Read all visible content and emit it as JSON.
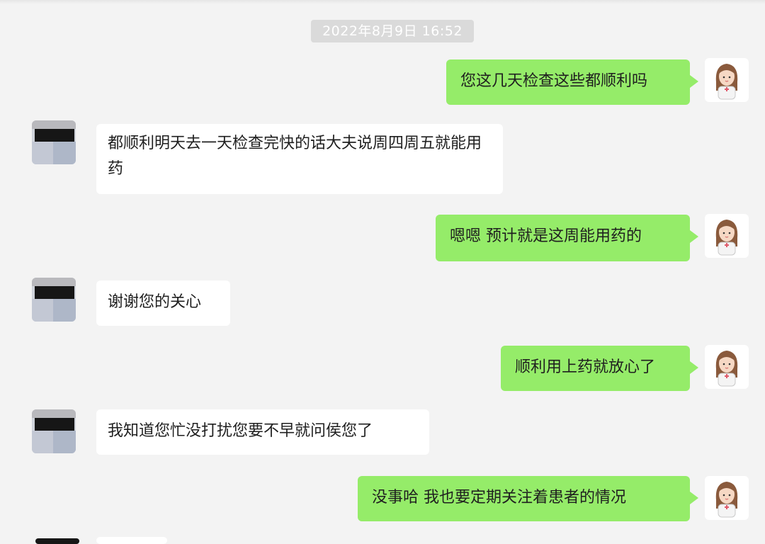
{
  "conversation": {
    "timestamp": "2022年8月9日 16:52",
    "messages": [
      {
        "sender": "self",
        "text": "您这几天检查这些都顺利吗"
      },
      {
        "sender": "other",
        "text": "都顺利明天去一天检查完快的话大夫说周四周五就能用药"
      },
      {
        "sender": "self",
        "text": "嗯嗯  预计就是这周能用药的"
      },
      {
        "sender": "other",
        "text": "谢谢您的关心"
      },
      {
        "sender": "self",
        "text": "顺利用上药就放心了"
      },
      {
        "sender": "other",
        "text": "我知道您忙没打扰您要不早就问侯您了"
      },
      {
        "sender": "self",
        "text": "没事哈   我也要定期关注着患者的情况"
      }
    ]
  },
  "colors": {
    "background": "#f3f3f3",
    "outgoing_bubble": "#95ec69",
    "incoming_bubble": "#ffffff",
    "timestamp_bg": "#dadada"
  },
  "icons": {
    "self_avatar": "cartoon-nurse-avatar-icon",
    "other_avatar": "pixelated-avatar-icon"
  }
}
